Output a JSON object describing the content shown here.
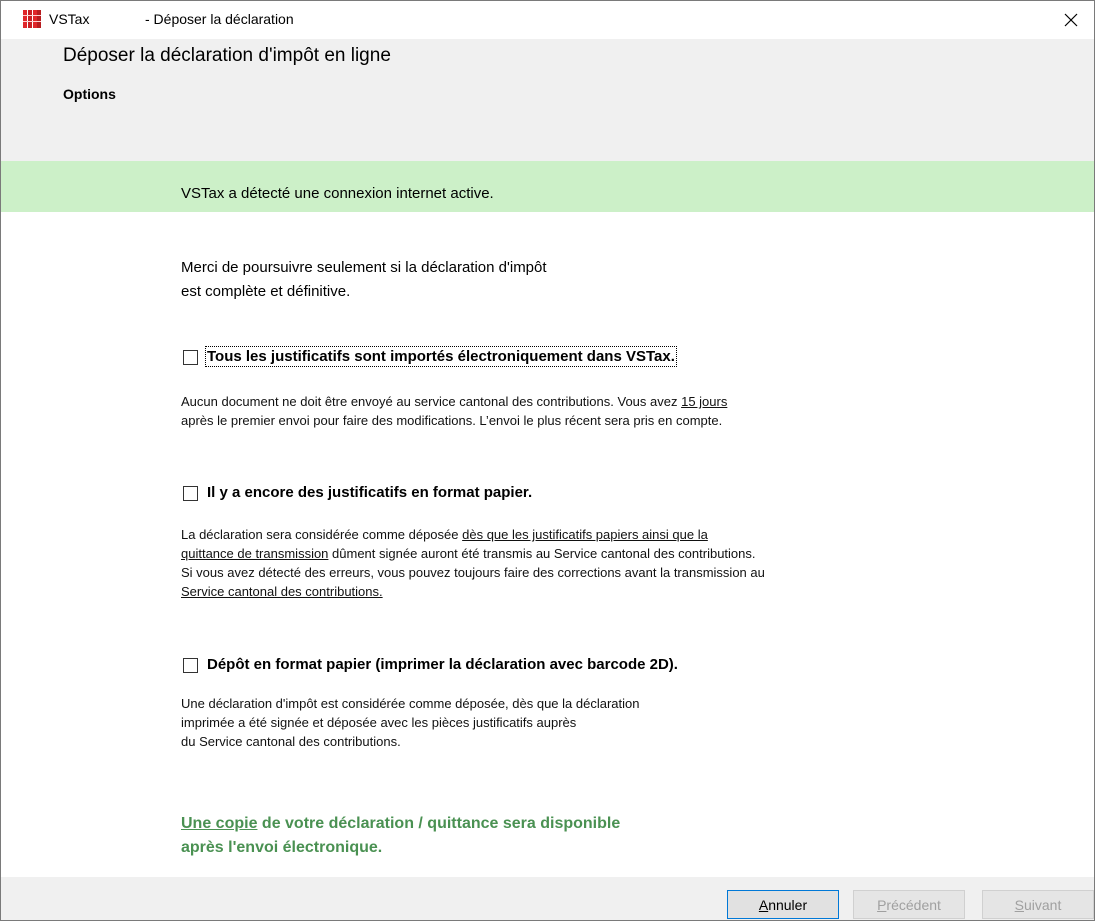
{
  "window": {
    "app_name": "VSTax",
    "title": "- Déposer la déclaration",
    "close_symbol": "✕"
  },
  "header": {
    "title": "Déposer la déclaration d'impôt en ligne",
    "subtitle": "Options"
  },
  "banner": {
    "text": "VSTax a détecté une connexion internet active.",
    "color": "#ccf0c8"
  },
  "intro": {
    "text": "Merci de poursuivre seulement si la déclaration d'impôt\nest complète et définitive."
  },
  "options": [
    {
      "label": "Tous les justificatifs sont importés électroniquement dans VSTax.",
      "checked": false,
      "desc_part1": "Aucun document ne doit être envoyé au service cantonal des contributions. Vous avez ",
      "desc_link": "15 jours",
      "desc_part2": "après le premier envoi pour faire des modifications. L’envoi le plus récent sera pris en compte."
    },
    {
      "label": "Il y a encore des justificatifs en format papier.",
      "checked": false,
      "desc_part1": "La déclaration sera considérée comme déposée ",
      "desc_link1a": "dès que les justificatifs papiers ainsi que la",
      "desc_link1b": "quittance de transmission",
      "desc_part2": " dûment signée auront été transmis au Service cantonal des contributions.",
      "desc_part3": "Si vous avez détecté des erreurs, vous pouvez toujours faire des corrections avant la transmission au",
      "desc_link2": "Service cantonal des contributions."
    },
    {
      "label": "Dépôt en format papier (imprimer la déclaration avec barcode 2D).",
      "checked": false,
      "desc_line1": "Une déclaration d'impôt est considérée comme déposée, dès que la déclaration",
      "desc_line2": "imprimée a été signée et déposée avec les pièces justificatifs auprès",
      "desc_line3": "du Service cantonal des contributions."
    }
  ],
  "note": {
    "link": "Une copie",
    "text1": " de votre déclaration / quittance sera disponible",
    "text2": "après l'envoi électronique.",
    "color": "#4a9152"
  },
  "footer": {
    "cancel_mnemonic": "A",
    "cancel_rest": "nnuler",
    "prev_mnemonic": "P",
    "prev_rest": "récédent",
    "next_mnemonic": "S",
    "next_rest": "uivant"
  }
}
